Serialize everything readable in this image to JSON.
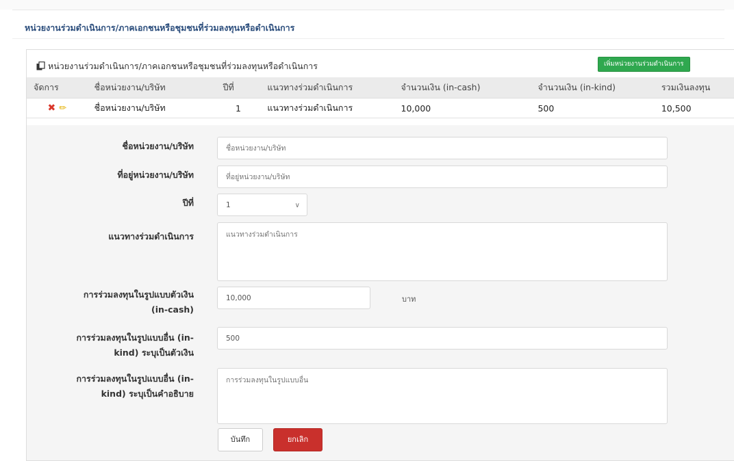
{
  "page_title": "หน่วยงานร่วมดำเนินการ/ภาคเอกชนหรือชุมชนที่ร่วมลงทุนหรือดำเนินการ",
  "panel": {
    "title": "หน่วยงานร่วมดำเนินการ/ภาคเอกชนหรือชุมชนที่ร่วมลงทุนหรือดำเนินการ",
    "add_button": "เพิ่มหน่วยงานร่วมดำเนินการ"
  },
  "table": {
    "headers": [
      "จัดการ",
      "ชื่อหน่วยงาน/บริษัท",
      "ปีที่",
      "แนวทางร่วมดำเนินการ",
      "จำนวนเงิน (in-cash)",
      "จำนวนเงิน (in-kind)",
      "รวมเงินลงทุน"
    ],
    "rows": [
      {
        "name": "ชื่อหน่วยงาน/บริษัท",
        "year": "1",
        "approach": "แนวทางร่วมดำเนินการ",
        "in_cash": "10,000",
        "in_kind": "500",
        "total": "10,500"
      }
    ]
  },
  "form": {
    "name_label": "ชื่อหน่วยงาน/บริษัท",
    "name_placeholder": "ชื่อหน่วยงาน/บริษัท",
    "address_label": "ที่อยู่หน่วยงาน/บริษัท",
    "address_placeholder": "ที่อยู่หน่วยงาน/บริษัท",
    "year_label": "ปีที่",
    "year_value": "1",
    "approach_label": "แนวทางร่วมดำเนินการ",
    "approach_placeholder": "แนวทางร่วมดำเนินการ",
    "cash_label_1": "การร่วมลงทุนในรูปแบบตัวเงิน",
    "cash_label_2": "(in-cash)",
    "cash_value": "10,000",
    "cash_unit": "บาท",
    "kind_money_label_1": "การร่วมลงทุนในรูปแบบอื่น (in-",
    "kind_money_label_2": "kind) ระบุเป็นตัวเงิน",
    "kind_money_value": "500",
    "kind_desc_label_1": "การร่วมลงทุนในรูปแบบอื่น (in-",
    "kind_desc_label_2": "kind) ระบุเป็นคำอธิบาย",
    "kind_desc_placeholder": "การร่วมลงทุนในรูปแบบอื่น",
    "save_label": "บันทึก",
    "cancel_label": "ยกเลิก"
  },
  "colors": {
    "title_blue": "#2b4d7c",
    "add_green": "#2fa84f",
    "cancel_red": "#c9302c",
    "edit_yellow": "#e4b000",
    "delete_red": "#d9362a"
  }
}
